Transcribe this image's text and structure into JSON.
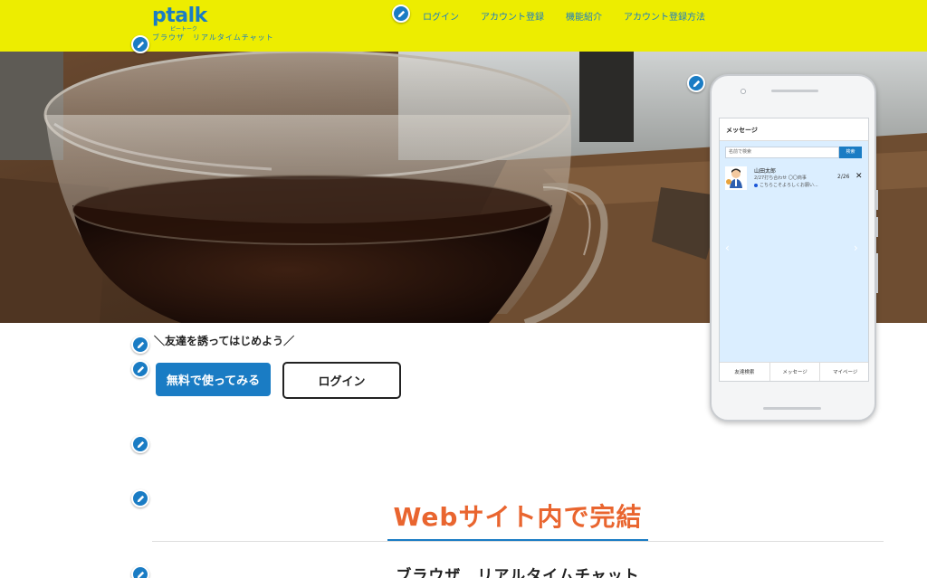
{
  "header": {
    "logo": "ptalk",
    "logo_sub": "ピートーク",
    "tagline": "ブラウザ　リアルタイムチャット",
    "nav": [
      "ログイン",
      "アカウント登録",
      "機能紹介",
      "アカウント登録方法"
    ]
  },
  "icons": {
    "edit": "pencil-icon"
  },
  "hero": {
    "phone": {
      "title": "メッセージ",
      "search_placeholder": "名前で検索",
      "search_button": "検索",
      "message": {
        "name": "山田太郎",
        "line2": "2/27打ち合わせ 〇〇商事",
        "line3": "こちらこそよろしくお願い...",
        "date": "2/26",
        "close": "✕"
      },
      "tabs": [
        "友達検索",
        "メッセージ",
        "マイページ"
      ]
    }
  },
  "cta": {
    "invite_text": "＼友達を誘ってはじめよう／",
    "primary_label": "無料で使ってみる",
    "login_label": "ログイン"
  },
  "section": {
    "title": "Webサイト内で完結",
    "subtitle": "ブラウザ　リアルタイムチャット"
  },
  "colors": {
    "header_bg": "#eded00",
    "brand_blue": "#1a7cc4",
    "accent_orange": "#e9652f"
  }
}
